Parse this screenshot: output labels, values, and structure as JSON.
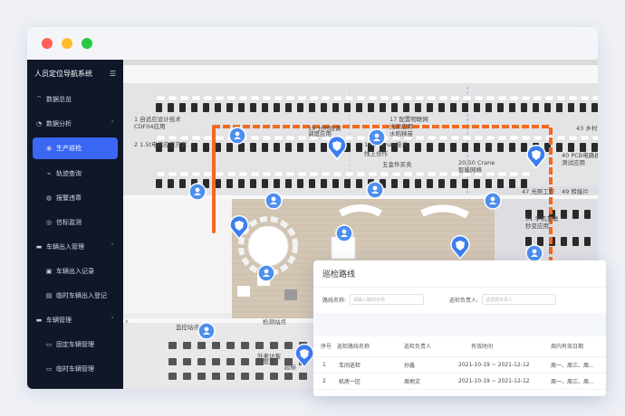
{
  "colors": {
    "sidebar_bg": "#0f1729",
    "accent": "#3c67f5",
    "route": "#f06a1f",
    "close": "#ff5f57",
    "minimize": "#febc2e",
    "maximize": "#28c840"
  },
  "sidebar": {
    "title": "人员定位导航系统",
    "menu_icon": "menu-icon",
    "items": [
      {
        "label": "数据总览",
        "icon": "wifi-icon",
        "level": 0,
        "active": false
      },
      {
        "label": "数据分析",
        "icon": "chart-icon",
        "level": 0,
        "active": false,
        "expanded": true
      },
      {
        "label": "生产巡检",
        "icon": "location-icon",
        "level": 1,
        "active": true
      },
      {
        "label": "轨迹查询",
        "icon": "track-icon",
        "level": 1,
        "active": false
      },
      {
        "label": "报警违章",
        "icon": "alarm-icon",
        "level": 1,
        "active": false
      },
      {
        "label": "信标监测",
        "icon": "beacon-icon",
        "level": 1,
        "active": false
      },
      {
        "label": "车辆出入管理",
        "icon": "truck-icon",
        "level": 0,
        "active": false,
        "expanded": true
      },
      {
        "label": "车辆出入记录",
        "icon": "record-icon",
        "level": 1,
        "active": false
      },
      {
        "label": "临时车辆出入登记",
        "icon": "register-icon",
        "level": 1,
        "active": false
      },
      {
        "label": "车辆管理",
        "icon": "truck-icon",
        "level": 0,
        "active": false,
        "expanded": true
      },
      {
        "label": "固定车辆管理",
        "icon": "car-icon",
        "level": 1,
        "active": false
      },
      {
        "label": "临时车辆管理",
        "icon": "car-icon",
        "level": 1,
        "active": false
      }
    ]
  },
  "map": {
    "labels": [
      "1 自适应设计技术",
      "CDF04应用",
      "2 1.5t电梯应用方案",
      "19 分时段调",
      "调度应用",
      "17 配置物联网",
      "光源应用",
      "水稻秧苗",
      "16.5 Smae技术",
      "线上合作",
      "五金件买卖",
      "20-50 Crane",
      "智能网络",
      "43 乡村",
      "40 PCB电路板",
      "测试应用",
      "47 光照工作",
      "49 转接片",
      "51 手机互联",
      "秒变应用",
      "监控站点",
      "检测站点",
      "外来访客",
      "顶管道",
      "超标"
    ]
  },
  "panel": {
    "title": "巡检路线",
    "route_name_label": "路线名称:",
    "route_name_placeholder": "请输入路线名称",
    "owner_label": "巡检负责人:",
    "owner_placeholder": "请选择负责人",
    "columns": [
      "序号",
      "巡检路线名称",
      "巡检负责人",
      "有效时间",
      "周内有效日期"
    ],
    "rows": [
      {
        "no": "1",
        "name": "车间巡检",
        "owner": "孙鑫",
        "time": "2021-10-19 ~ 2021-12-12",
        "days": "周一、周三、周..."
      },
      {
        "no": "2",
        "name": "机房一区",
        "owner": "周地文",
        "time": "2021-10-19 ~ 2021-12-12",
        "days": "周一、周三、周..."
      }
    ]
  }
}
